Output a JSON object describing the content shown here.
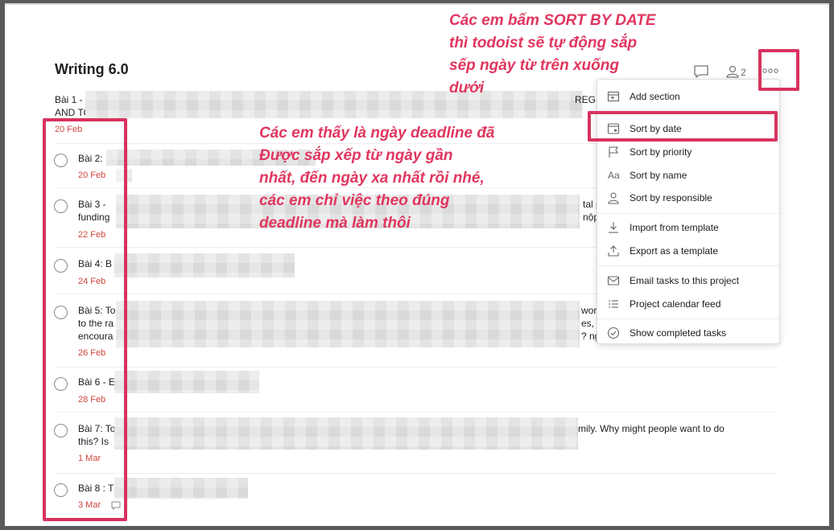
{
  "project": {
    "title": "Writing 6.0",
    "collaborator_count": "2"
  },
  "header_icons": {
    "comment": "comment-icon",
    "collaborators": "person-icon",
    "more": "more-dots-icon"
  },
  "task_list": {
    "first_task": {
      "line1_start": "Bài 1 - ",
      "line1_end": "REG",
      "line2": "AND TO",
      "date": "20 Feb"
    },
    "tasks": [
      {
        "lines": [
          "Bài 2:"
        ],
        "date": "20 Feb"
      },
      {
        "lines": [
          "Bài 3 - ",
          "funding"
        ],
        "tail": [
          "tal p",
          "nộp"
        ],
        "date": "22 Feb"
      },
      {
        "lines": [
          "Bài 4: B"
        ],
        "date": "24 Feb"
      },
      {
        "lines": [
          "Bài 5: To",
          "to the ra",
          "encoura"
        ],
        "tail": [
          "wor",
          "es, a",
          "? ng"
        ],
        "date": "26 Feb"
      },
      {
        "lines": [
          "Bài 6 - E"
        ],
        "date": "28 Feb"
      },
      {
        "lines": [
          "Bài 7: To",
          "this? Is"
        ],
        "tail": [
          "mily. Why might people want to do"
        ],
        "date": "1 Mar"
      },
      {
        "lines": [
          "Bài 8 : T"
        ],
        "date": "3 Mar"
      }
    ]
  },
  "more_menu": {
    "groups": [
      [
        {
          "label": "Add section",
          "icon": "add-section-icon"
        }
      ],
      [
        {
          "label": "Sort by date",
          "icon": "calendar-icon"
        },
        {
          "label": "Sort by priority",
          "icon": "flag-icon"
        },
        {
          "label": "Sort by name",
          "icon": "text-aa-icon"
        },
        {
          "label": "Sort by responsible",
          "icon": "person-icon"
        }
      ],
      [
        {
          "label": "Import from template",
          "icon": "import-icon"
        },
        {
          "label": "Export as a template",
          "icon": "export-icon"
        }
      ],
      [
        {
          "label": "Email tasks to this project",
          "icon": "email-icon"
        },
        {
          "label": "Project calendar feed",
          "icon": "list-icon"
        }
      ],
      [
        {
          "label": "Show completed tasks",
          "icon": "check-circle-icon"
        }
      ]
    ]
  },
  "annotations": {
    "top_note": "Các em bấm SORT BY DATE\nthì todoist sẽ tự động sắp\nsếp ngày từ trên xuống\ndưới",
    "middle_note": "Các em thấy là ngày deadline đã\nĐược sắp xếp từ ngày gần\nnhất, đến ngày xa nhất rồi nhé,\ncác em chỉ việc theo đúng\ndeadline mà làm thôi"
  },
  "colors": {
    "annotation": "#e0365e",
    "highlight_box": "#d7335f",
    "due_date": "#d1453b"
  }
}
